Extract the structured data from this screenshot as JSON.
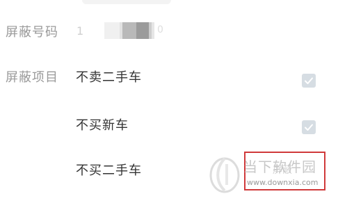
{
  "fields": {
    "block_number_label": "屏蔽号码",
    "block_number_value_prefix": "1",
    "block_number_value_suffix": "0",
    "block_items_label": "屏蔽项目"
  },
  "options": [
    {
      "label": "不卖二手车",
      "checked": true
    },
    {
      "label": "不买新车",
      "checked": true
    },
    {
      "label": "不买二手车",
      "checked": false
    }
  ],
  "watermark": {
    "title": "当下软件园",
    "url": "www.downxia.com",
    "ghost_text": "屏蔽"
  },
  "colors": {
    "label": "#9a9a9a",
    "text": "#333333",
    "checkbox": "#d6dde3",
    "watermark_border": "#d0393a"
  }
}
